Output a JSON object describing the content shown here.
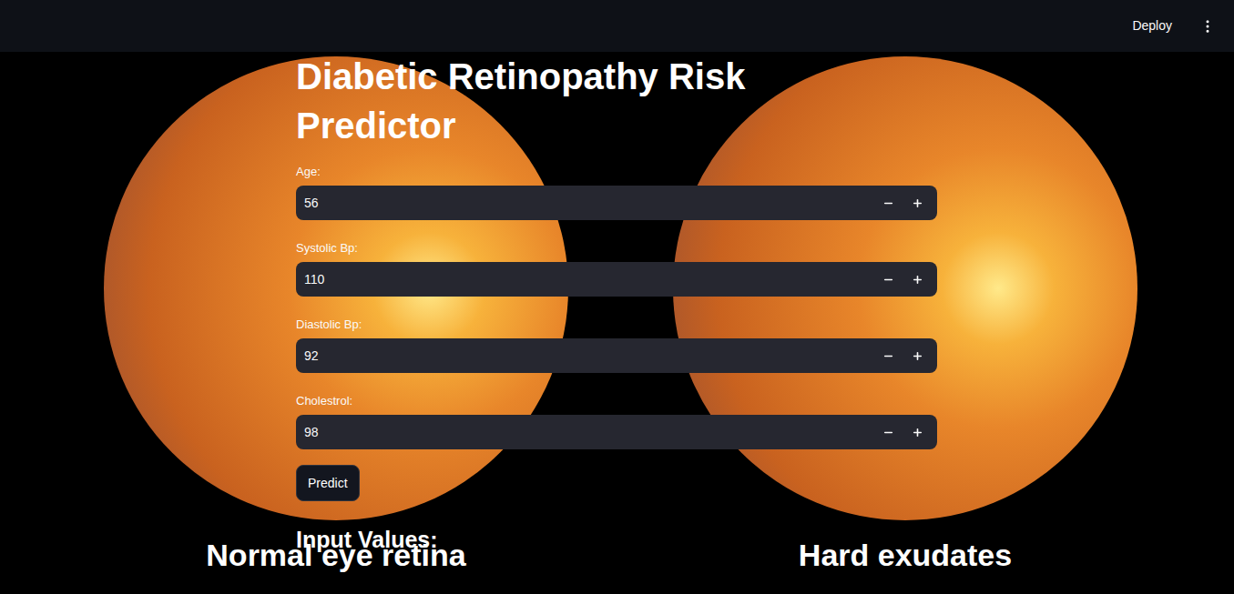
{
  "header": {
    "deploy": "Deploy"
  },
  "title": "Diabetic Retinopathy Risk Predictor",
  "fields": [
    {
      "label": "Age:",
      "value": "56",
      "minus": "−",
      "plus": "+"
    },
    {
      "label": "Systolic Bp:",
      "value": "110",
      "minus": "−",
      "plus": "+"
    },
    {
      "label": "Diastolic Bp:",
      "value": "92",
      "minus": "−",
      "plus": "+"
    },
    {
      "label": "Cholestrol:",
      "value": "98",
      "minus": "−",
      "plus": "+"
    }
  ],
  "predict_button": "Predict",
  "results_heading": "Input Values:",
  "background": {
    "captions": [
      "Normal eye retina",
      "Hard exudates"
    ]
  }
}
